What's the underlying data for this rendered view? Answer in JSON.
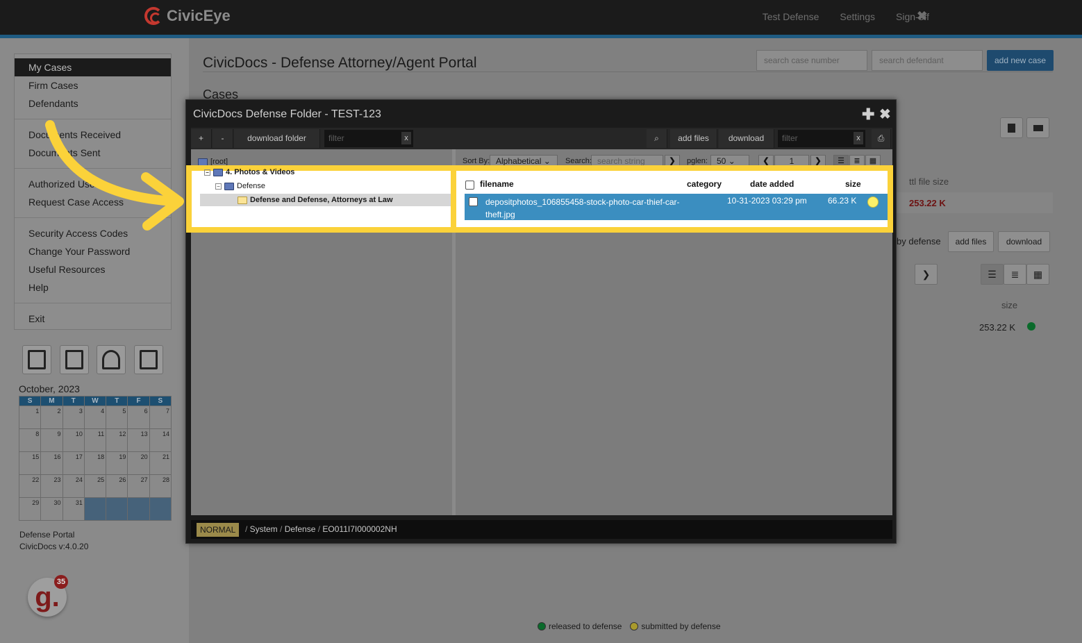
{
  "app": {
    "name": "CivicEye"
  },
  "topnav": {
    "items": [
      "Test Defense",
      "Settings",
      "Sign-off"
    ],
    "close": "✖"
  },
  "sidebar": {
    "menu": [
      "My Cases",
      "Firm Cases",
      "Defendants",
      "Documents Received",
      "Documents Sent",
      "Authorized Users",
      "Request Case Access",
      "Security Access Codes",
      "Change Your Password",
      "Useful Resources",
      "Help",
      "Exit"
    ],
    "tools": [
      "calculator-icon",
      "calendar-icon",
      "map-icon",
      "book-icon"
    ],
    "calendar": {
      "title": "October, 2023",
      "days": [
        "S",
        "M",
        "T",
        "W",
        "T",
        "F",
        "S"
      ],
      "weeks": [
        [
          "1",
          "2",
          "3",
          "4",
          "5",
          "6",
          "7"
        ],
        [
          "8",
          "9",
          "10",
          "11",
          "12",
          "13",
          "14"
        ],
        [
          "15",
          "16",
          "17",
          "18",
          "19",
          "20",
          "21"
        ],
        [
          "22",
          "23",
          "24",
          "25",
          "26",
          "27",
          "28"
        ],
        [
          "29",
          "30",
          "31",
          "",
          "",
          "",
          ""
        ]
      ]
    },
    "portal": "Defense Portal",
    "version": "CivicDocs v:4.0.20",
    "badge_count": "35",
    "badge_letter": "g."
  },
  "main": {
    "title": "CivicDocs - Defense Attorney/Agent Portal",
    "search_case_placeholder": "search case number",
    "search_defendant_placeholder": "search defendant",
    "add_case": "add new case",
    "cases_title": "Cases",
    "col_ttl_size": "ttl file size",
    "ttl_size_value": "253.22 K",
    "by_defense": "by defense",
    "add_files": "add files",
    "download": "download",
    "col_size": "size",
    "size_value": "253.22 K",
    "legend": {
      "released": "released to defense",
      "submitted": "submitted by defense"
    },
    "colors": {
      "released": "#0a6a2b",
      "submitted": "#d6c83c"
    }
  },
  "modal": {
    "title": "CivicDocs Defense Folder - TEST-123",
    "toolbar": {
      "plus": "+",
      "minus": "-",
      "download_folder": "download folder",
      "filter_placeholder": "filter",
      "clear": "x",
      "add_files": "add files",
      "download": "download",
      "filter2_placeholder": "filter"
    },
    "tree": {
      "root": "[root]",
      "nodes": [
        "4. Photos & Videos",
        "Defense",
        "Defense and Defense, Attorneys at Law"
      ]
    },
    "sortbar": {
      "sort_by_label": "Sort By:",
      "sort_by_value": "Alphabetical",
      "search_label": "Search:",
      "search_placeholder": "search string",
      "pglen_label": "pglen:",
      "pglen_value": "50",
      "page": "1"
    },
    "file_table": {
      "headers": {
        "filename": "filename",
        "category": "category",
        "date_added": "date added",
        "size": "size"
      },
      "rows": [
        {
          "filename": "depositphotos_106855458-stock-photo-car-thief-car-theft.jpg",
          "category": "",
          "date_added": "10-31-2023 03:29 pm",
          "size": "66.23 K",
          "status": "submitted"
        }
      ]
    },
    "status": {
      "mode": "NORMAL",
      "path": [
        "System",
        "Defense",
        "EO011I7I000002NH"
      ]
    }
  }
}
